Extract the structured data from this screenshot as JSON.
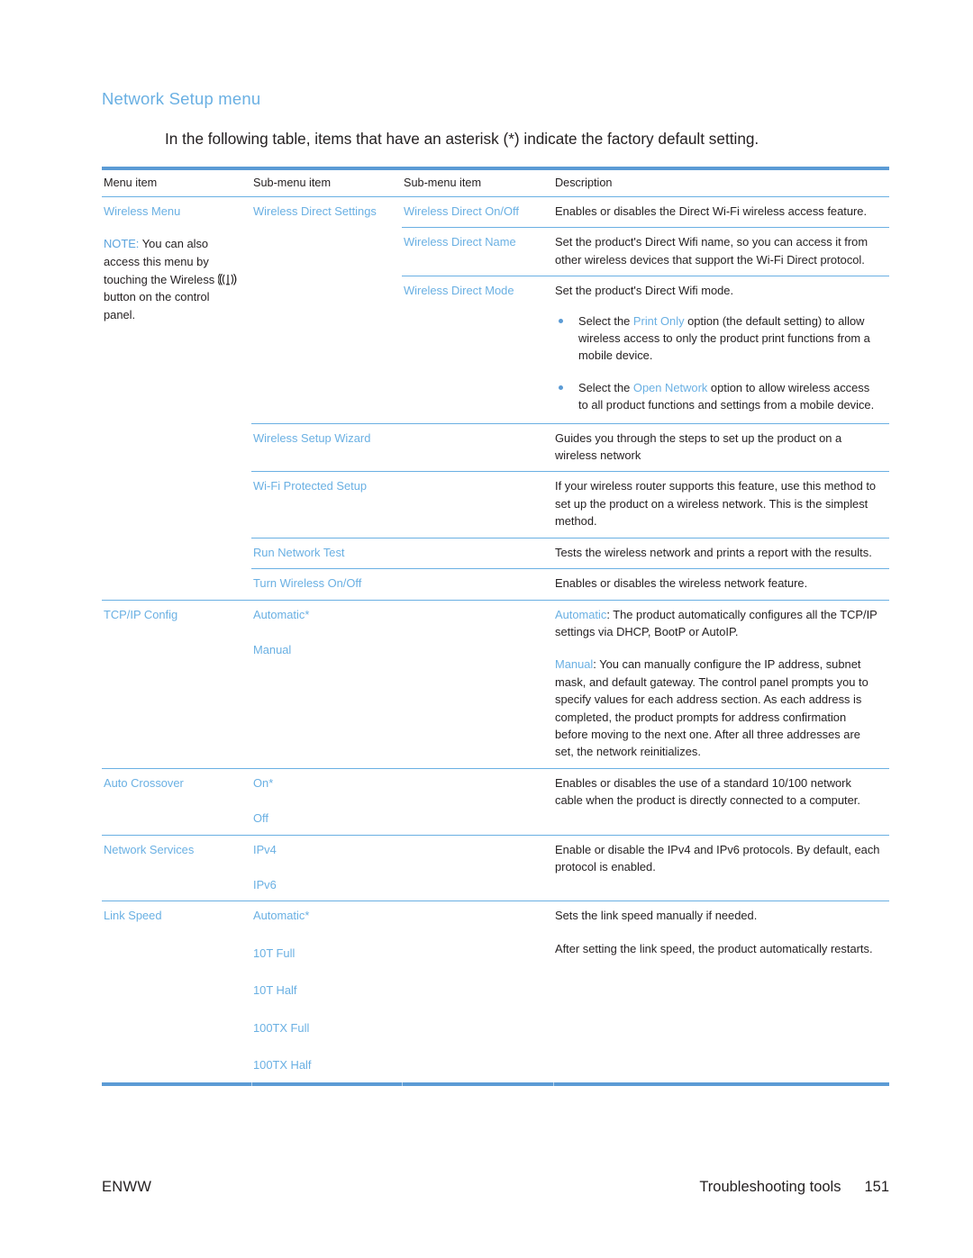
{
  "page": {
    "heading": "Network Setup menu",
    "intro": "In the following table, items that have an asterisk (*) indicate the factory default setting."
  },
  "table": {
    "headers": {
      "col1": "Menu item",
      "col2": "Sub-menu item",
      "col3": "Sub-menu item",
      "col4": "Description"
    },
    "rows": [
      {
        "menu_item": "Wireless Menu",
        "note_label": "NOTE:",
        "note_text_1": "You can also access this menu by touching the Wireless",
        "note_icon": "wireless-signal-icon",
        "note_text_2": "button on the control panel.",
        "sub_menu_1": "Wireless Direct Settings",
        "sub_menu_2": "Wireless Direct On/Off",
        "description": "Enables or disables the Direct Wi-Fi wireless access feature."
      },
      {
        "sub_menu_2": "Wireless Direct Name",
        "description": "Set the product's Direct Wifi name, so you can access it from other wireless devices that support the Wi-Fi Direct protocol."
      },
      {
        "sub_menu_2": "Wireless Direct Mode",
        "description": "Set the product's Direct Wifi mode.",
        "bullets": [
          {
            "pre": "Select the ",
            "link": "Print Only",
            "post": " option (the default setting) to allow wireless access to only the product print functions from a mobile device."
          },
          {
            "pre": "Select the ",
            "link": "Open Network",
            "post": " option to allow wireless access to all product functions and settings from a mobile device."
          }
        ]
      },
      {
        "sub_menu_1": "Wireless Setup Wizard",
        "description": "Guides you through the steps to set up the product on a wireless network"
      },
      {
        "sub_menu_1": "Wi-Fi Protected Setup",
        "description": "If your wireless router supports this feature, use this method to set up the product on a wireless network. This is the simplest method."
      },
      {
        "sub_menu_1": "Run Network Test",
        "description": "Tests the wireless network and prints a report with the results."
      },
      {
        "sub_menu_1": "Turn Wireless On/Off",
        "description": "Enables or disables the wireless network feature."
      },
      {
        "menu_item": "TCP/IP Config",
        "sub_menu_1": "Automatic*",
        "sub_menu_1b": "Manual",
        "desc_p1_link": "Automatic",
        "desc_p1_text": ": The product automatically configures all the TCP/IP settings via DHCP, BootP or AutoIP.",
        "desc_p2_link": "Manual",
        "desc_p2_text": ": You can manually configure the IP address, subnet mask, and default gateway. The control panel prompts you to specify values for each address section. As each address is completed, the product prompts for address confirmation before moving to the next one. After all three addresses are set, the network reinitializes."
      },
      {
        "menu_item": "Auto Crossover",
        "sub_menu_1": "On*",
        "sub_menu_1b": "Off",
        "description": "Enables or disables the use of a standard 10/100 network cable when the product is directly connected to a computer."
      },
      {
        "menu_item": "Network Services",
        "sub_menu_1": "IPv4",
        "sub_menu_1b": "IPv6",
        "description": "Enable or disable the IPv4 and IPv6 protocols. By default, each protocol is enabled."
      },
      {
        "menu_item": "Link Speed",
        "sub_menu_1": "Automatic*",
        "sub_menu_options": [
          "10T Full",
          "10T Half",
          "100TX Full",
          "100TX Half"
        ],
        "desc_p1": "Sets the link speed manually if needed.",
        "desc_p2": "After setting the link speed, the product automatically restarts."
      }
    ]
  },
  "footer": {
    "left": "ENWW",
    "section": "Troubleshooting tools",
    "page_number": "151"
  },
  "colors": {
    "accent_blue": "#6ab0e3",
    "rule_blue": "#5b9bd5",
    "body_text": "#231f20"
  }
}
